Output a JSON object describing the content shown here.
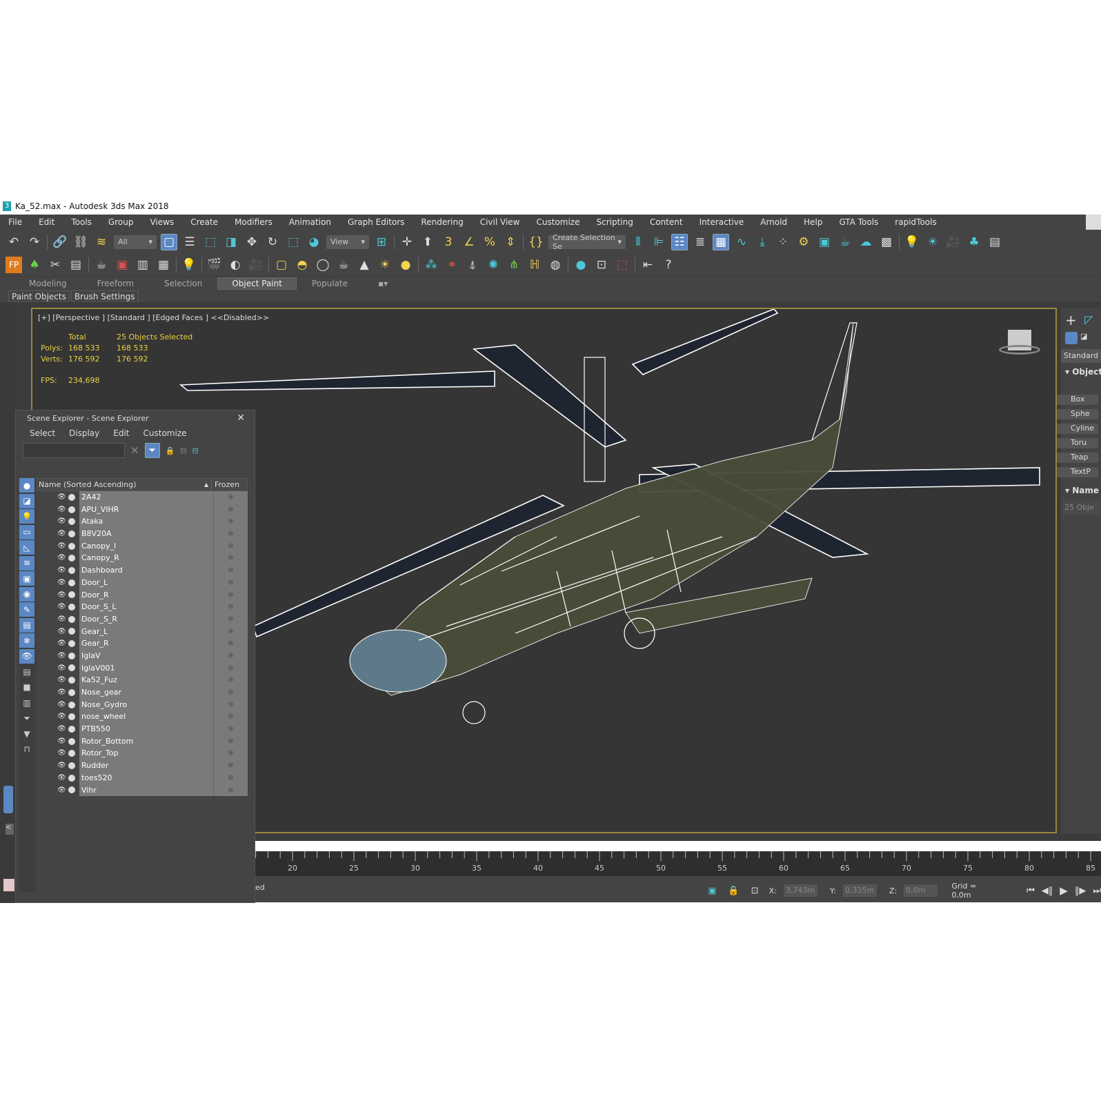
{
  "window_title": "Ka_52.max - Autodesk 3ds Max 2018",
  "menu": [
    "File",
    "Edit",
    "Tools",
    "Group",
    "Views",
    "Create",
    "Modifiers",
    "Animation",
    "Graph Editors",
    "Rendering",
    "Civil View",
    "Customize",
    "Scripting",
    "Content",
    "Interactive",
    "Arnold",
    "Help",
    "GTA Tools",
    "rapidTools"
  ],
  "toolbar": {
    "selection_filter": "All",
    "ref_coord": "View",
    "named_selection": "Create Selection Se"
  },
  "ribbon": {
    "tabs": [
      "Modeling",
      "Freeform",
      "Selection",
      "Object Paint",
      "Populate"
    ],
    "active": "Object Paint",
    "sub": [
      "Paint Objects",
      "Brush Settings"
    ]
  },
  "viewport": {
    "label": "[+] [Perspective ] [Standard ] [Edged Faces ]  <<Disabled>>",
    "stats": {
      "total_label": "Total",
      "selected_label": "25 Objects Selected",
      "polys_label": "Polys:",
      "polys_total": "168 533",
      "polys_sel": "168 533",
      "verts_label": "Verts:",
      "verts_total": "176 592",
      "verts_sel": "176 592",
      "fps_label": "FPS:",
      "fps": "234,698"
    }
  },
  "scene_explorer": {
    "title": "Scene Explorer - Scene Explorer",
    "menu": [
      "Select",
      "Display",
      "Edit",
      "Customize"
    ],
    "search_value": "",
    "col_name": "Name (Sorted Ascending)",
    "col_frozen": "Frozen",
    "objects": [
      "2A42",
      "APU_VIHR",
      "Ataka",
      "B8V20A",
      "Canopy_l",
      "Canopy_R",
      "Dashboard",
      "Door_L",
      "Door_R",
      "Door_S_L",
      "Door_S_R",
      "Gear_L",
      "Gear_R",
      "IglaV",
      "IglaV001",
      "Ka52_Fuz",
      "Nose_gear",
      "Nose_Gydro",
      "nose_wheel",
      "PTB550",
      "Rotor_Bottom",
      "Rotor_Top",
      "Rudder",
      "toes520",
      "Vihr"
    ]
  },
  "command_panel": {
    "category": "Standard P",
    "rollout_object": "Object",
    "buttons": [
      "Box",
      "Sphe",
      "Cyline",
      "Toru",
      "Teap",
      "TextP"
    ],
    "rollout_name": "Name",
    "name_value": "25 Obje"
  },
  "timeline": {
    "labels": [
      "20",
      "25",
      "30",
      "35",
      "40",
      "45",
      "50",
      "55",
      "60",
      "65",
      "70",
      "75",
      "80",
      "85"
    ]
  },
  "status": {
    "prompt": "ed",
    "x_label": "X:",
    "x": "3,743m",
    "y_label": "Y:",
    "y": "0,335m",
    "z_label": "Z:",
    "z": "0,0m",
    "grid": "Grid = 0,0m"
  }
}
